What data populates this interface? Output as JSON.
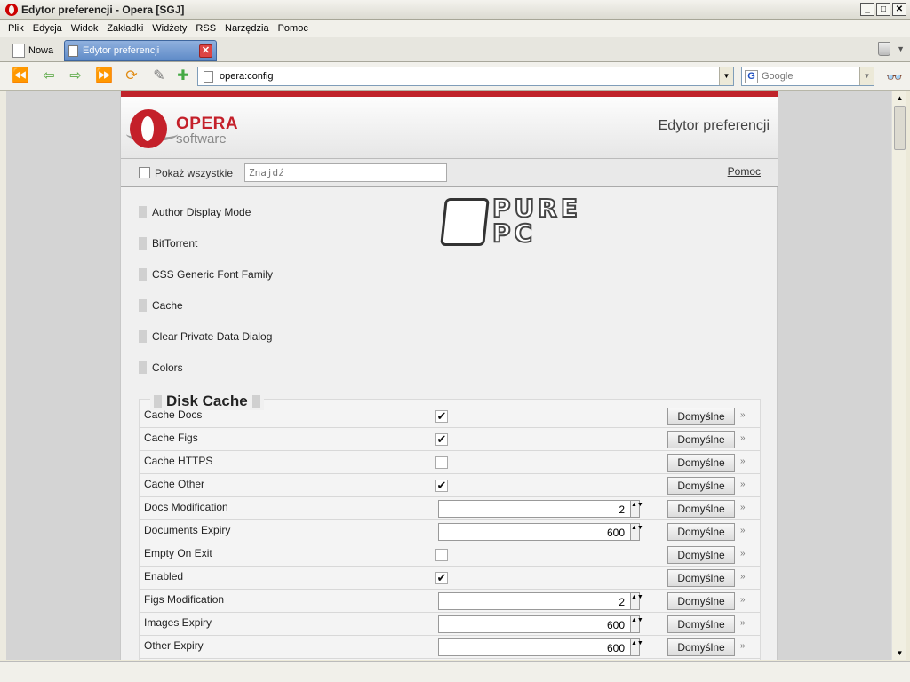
{
  "window": {
    "title": "Edytor preferencji - Opera [SGJ]"
  },
  "menu": [
    {
      "label": "Plik"
    },
    {
      "label": "Edycja"
    },
    {
      "label": "Widok"
    },
    {
      "label": "Zakładki"
    },
    {
      "label": "Widżety"
    },
    {
      "label": "RSS"
    },
    {
      "label": "Narzędzia"
    },
    {
      "label": "Pomoc"
    }
  ],
  "tabs": {
    "new_label": "Nowa",
    "active_label": "Edytor preferencji"
  },
  "nav": {
    "address": "opera:config",
    "search_placeholder": "Google"
  },
  "page": {
    "logo_text1": "OPERA",
    "logo_text2": "software",
    "header_title": "Edytor preferencji",
    "show_all_label": "Pokaż wszystkie",
    "find_placeholder": "Znajdź",
    "help_label": "Pomoc",
    "watermark": "PURE PC"
  },
  "sections": [
    "Author Display Mode",
    "BitTorrent",
    "CSS Generic Font Family",
    "Cache",
    "Clear Private Data Dialog",
    "Colors"
  ],
  "disk_cache": {
    "title": "Disk Cache",
    "default_label": "Domyślne",
    "more_glyph": "»",
    "rows": [
      {
        "name": "Cache Docs",
        "type": "check",
        "checked": true
      },
      {
        "name": "Cache Figs",
        "type": "check",
        "checked": true
      },
      {
        "name": "Cache HTTPS",
        "type": "check",
        "checked": false
      },
      {
        "name": "Cache Other",
        "type": "check",
        "checked": true
      },
      {
        "name": "Docs Modification",
        "type": "number",
        "value": "2"
      },
      {
        "name": "Documents Expiry",
        "type": "number",
        "value": "600"
      },
      {
        "name": "Empty On Exit",
        "type": "check",
        "checked": false
      },
      {
        "name": "Enabled",
        "type": "check",
        "checked": true
      },
      {
        "name": "Figs Modification",
        "type": "number",
        "value": "2"
      },
      {
        "name": "Images Expiry",
        "type": "number",
        "value": "600"
      },
      {
        "name": "Other Expiry",
        "type": "number",
        "value": "600"
      }
    ]
  },
  "colors": {
    "accent_red": "#c0232a",
    "tab_blue": "#5f8bc8"
  }
}
